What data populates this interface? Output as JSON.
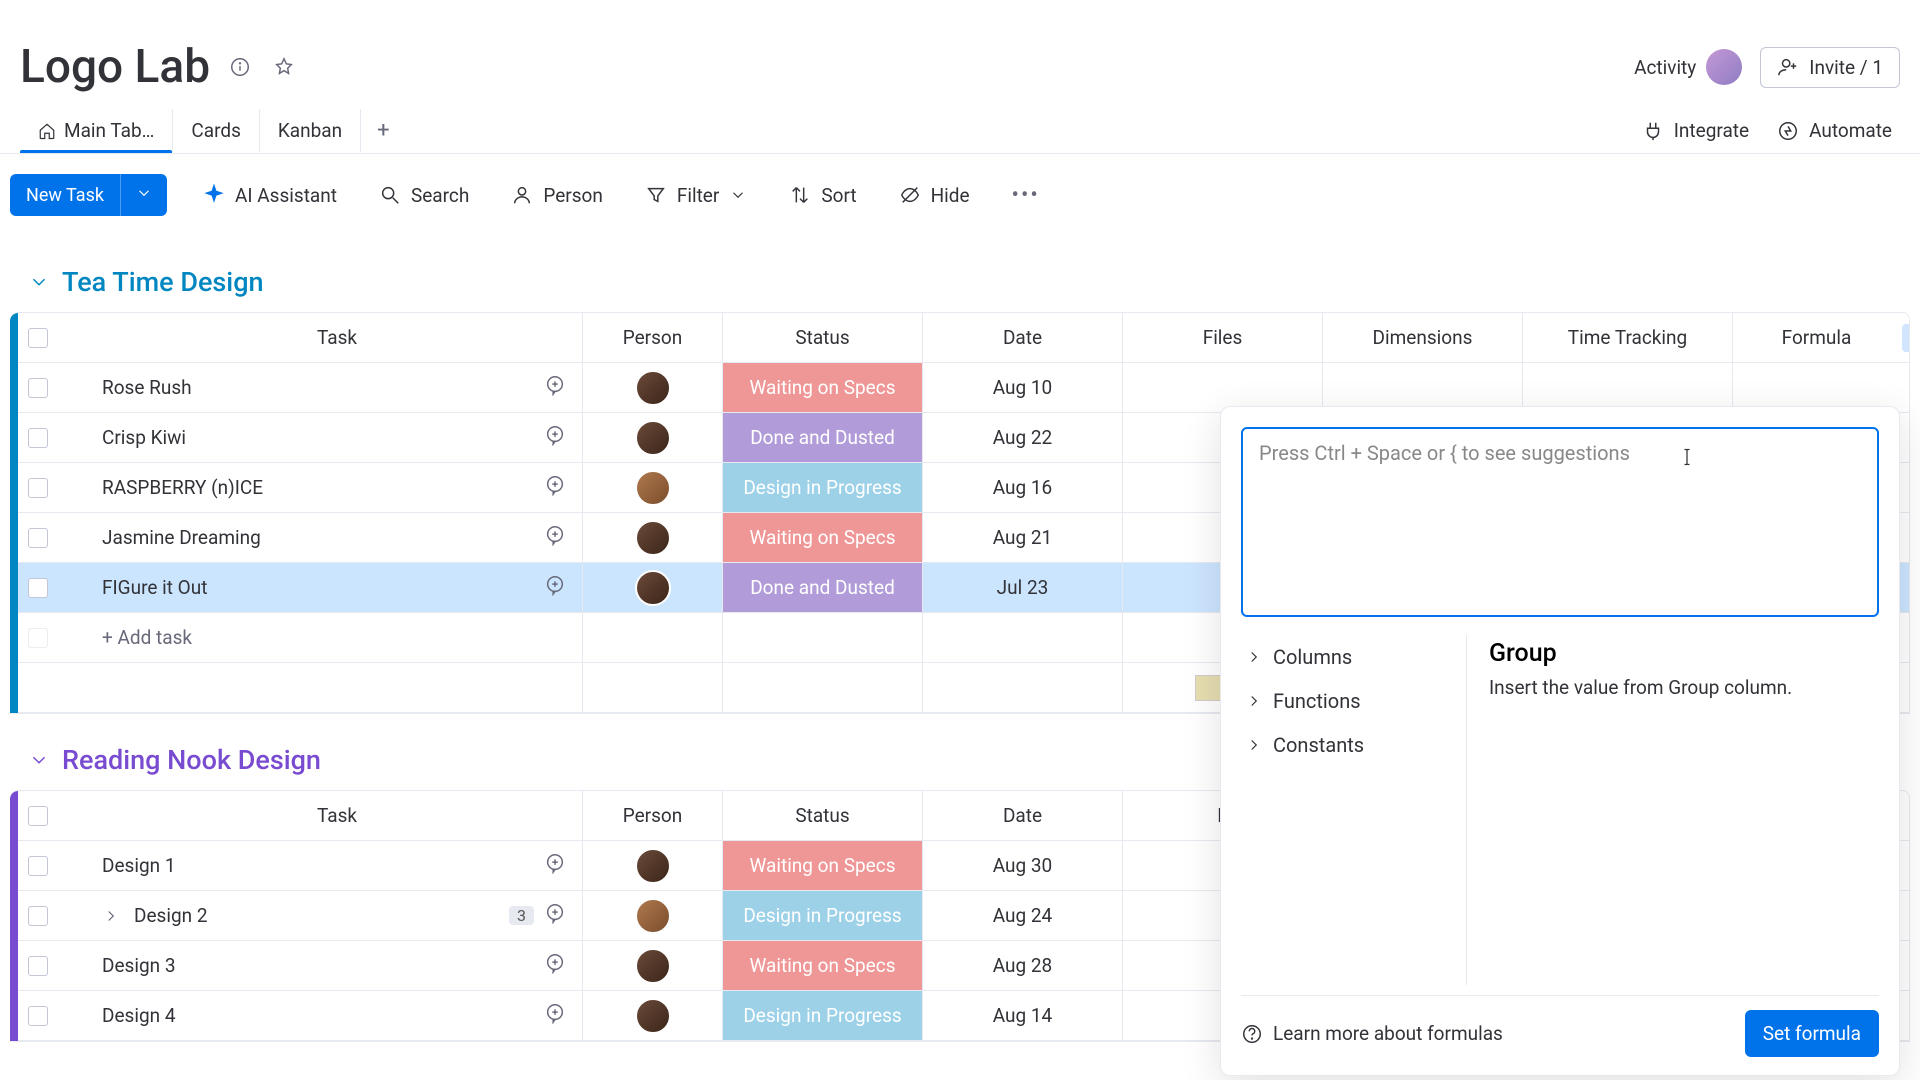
{
  "header": {
    "title": "Logo Lab",
    "activity_label": "Activity",
    "invite_label": "Invite / 1"
  },
  "tabs": {
    "items": [
      "Main Tab…",
      "Cards",
      "Kanban"
    ],
    "active_index": 0,
    "integrate": "Integrate",
    "automate": "Automate"
  },
  "toolbar": {
    "new_task": "New Task",
    "ai": "AI Assistant",
    "search": "Search",
    "person": "Person",
    "filter": "Filter",
    "sort": "Sort",
    "hide": "Hide"
  },
  "columns": [
    "Task",
    "Person",
    "Status",
    "Date",
    "Files",
    "Dimensions",
    "Time Tracking",
    "Formula"
  ],
  "groups": [
    {
      "name": "Tea Time Design",
      "color": "#0086c0",
      "rows": [
        {
          "task": "Rose Rush",
          "status": "Waiting on Specs",
          "status_class": "st-waiting",
          "date": "Aug 10",
          "selected": false,
          "avatar": "a"
        },
        {
          "task": "Crisp Kiwi",
          "status": "Done and Dusted",
          "status_class": "st-done",
          "date": "Aug 22",
          "selected": false,
          "avatar": "a"
        },
        {
          "task": "RASPBERRY (n)ICE",
          "status": "Design in Progress",
          "status_class": "st-progress",
          "date": "Aug 16",
          "selected": false,
          "avatar": "b"
        },
        {
          "task": "Jasmine Dreaming",
          "status": "Waiting on Specs",
          "status_class": "st-waiting",
          "date": "Aug 21",
          "selected": false,
          "avatar": "a"
        },
        {
          "task": "FIGure it Out",
          "status": "Done and Dusted",
          "status_class": "st-done",
          "date": "Jul 23",
          "selected": true,
          "avatar": "a"
        }
      ],
      "add_task": "+ Add task"
    },
    {
      "name": "Reading Nook Design",
      "color": "#784bd1",
      "rows": [
        {
          "task": "Design 1",
          "status": "Waiting on Specs",
          "status_class": "st-waiting",
          "date": "Aug 30",
          "avatar": "a"
        },
        {
          "task": "Design 2",
          "status": "Design in Progress",
          "status_class": "st-progress",
          "date": "Aug 24",
          "avatar": "b",
          "sub": "3",
          "expandable": true
        },
        {
          "task": "Design 3",
          "status": "Waiting on Specs",
          "status_class": "st-waiting",
          "date": "Aug 28",
          "avatar": "a"
        },
        {
          "task": "Design 4",
          "status": "Design in Progress",
          "status_class": "st-progress",
          "date": "Aug 14",
          "avatar": "a"
        }
      ]
    }
  ],
  "formula_popover": {
    "placeholder": "Press Ctrl + Space or { to see suggestions",
    "categories": [
      "Columns",
      "Functions",
      "Constants"
    ],
    "detail_title": "Group",
    "detail_desc": "Insert the value from Group column.",
    "learn": "Learn more about formulas",
    "set": "Set formula"
  }
}
